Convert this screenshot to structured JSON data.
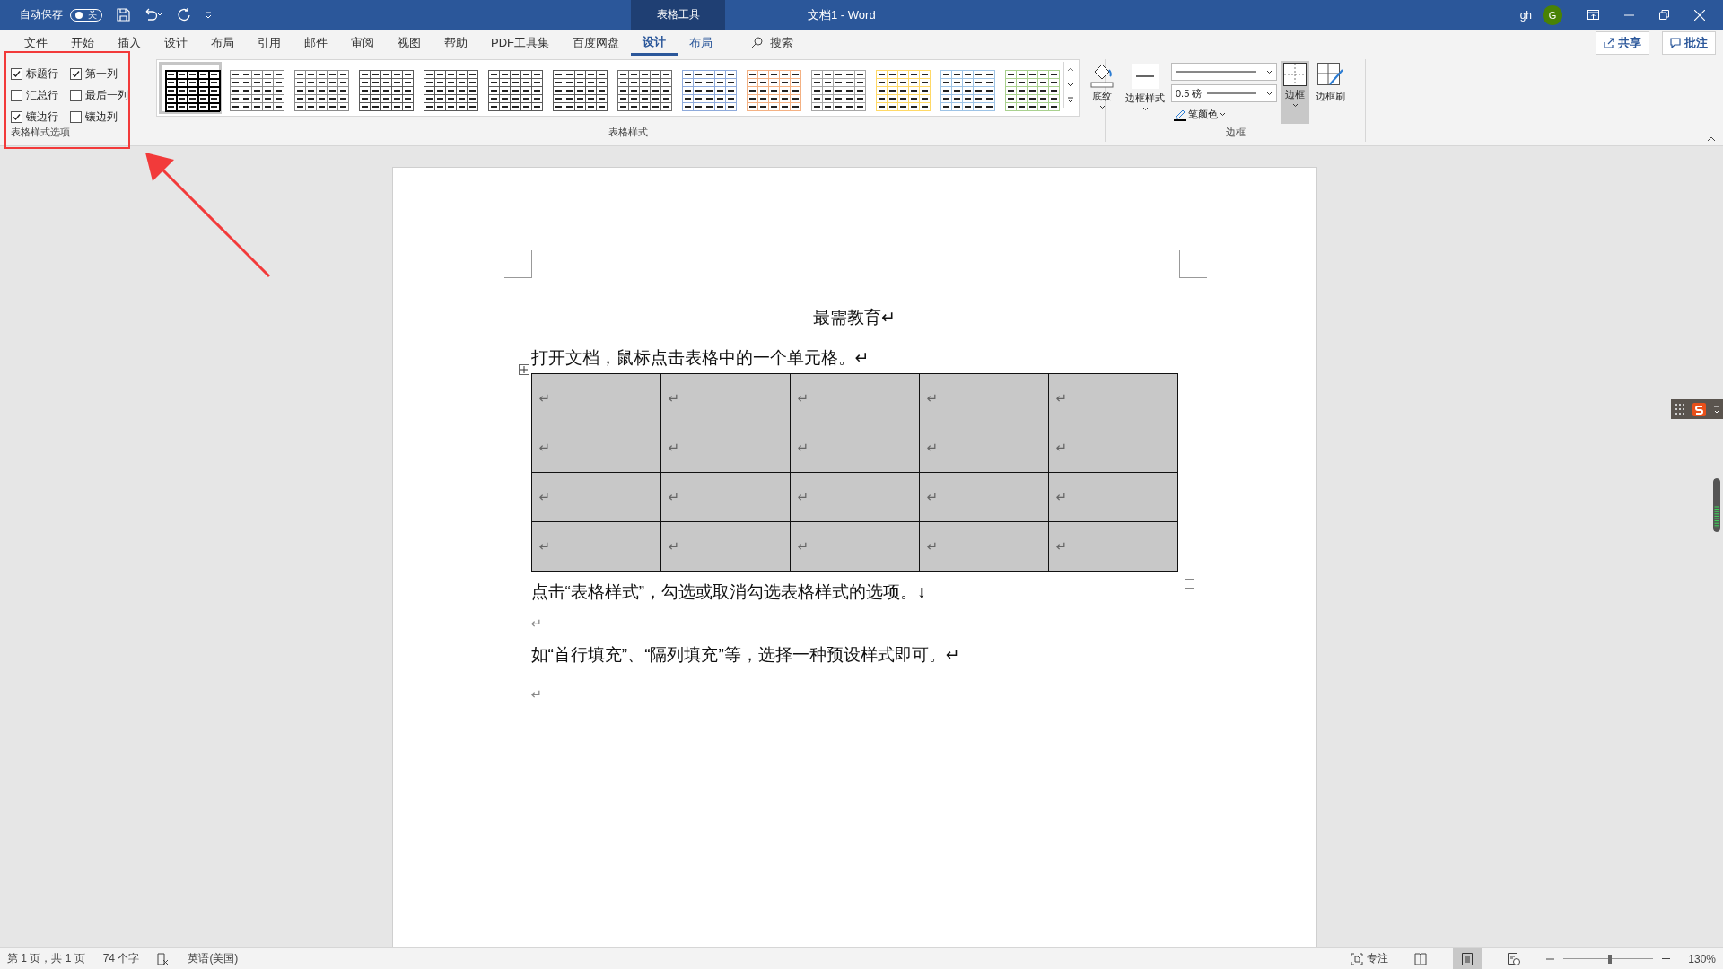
{
  "title_bar": {
    "autosave_label": "自动保存",
    "autosave_toggle": {
      "label": "关",
      "on": false
    },
    "context_tab": "表格工具",
    "title": "文档1  -  Word",
    "user": "gh",
    "avatar": "G"
  },
  "ribbon_tabs": [
    {
      "label": "文件",
      "selected": false,
      "contextual": false
    },
    {
      "label": "开始",
      "selected": false,
      "contextual": false
    },
    {
      "label": "插入",
      "selected": false,
      "contextual": false
    },
    {
      "label": "设计",
      "selected": false,
      "contextual": false
    },
    {
      "label": "布局",
      "selected": false,
      "contextual": false
    },
    {
      "label": "引用",
      "selected": false,
      "contextual": false
    },
    {
      "label": "邮件",
      "selected": false,
      "contextual": false
    },
    {
      "label": "审阅",
      "selected": false,
      "contextual": false
    },
    {
      "label": "视图",
      "selected": false,
      "contextual": false
    },
    {
      "label": "帮助",
      "selected": false,
      "contextual": false
    },
    {
      "label": "PDF工具集",
      "selected": false,
      "contextual": false
    },
    {
      "label": "百度网盘",
      "selected": false,
      "contextual": false
    },
    {
      "label": "设计",
      "selected": true,
      "contextual": true
    },
    {
      "label": "布局",
      "selected": false,
      "contextual": true
    }
  ],
  "search": {
    "placeholder": "搜索"
  },
  "share_button": "共享",
  "comments_button": "批注",
  "style_options": {
    "items": [
      {
        "label": "标题行",
        "checked": true
      },
      {
        "label": "第一列",
        "checked": true
      },
      {
        "label": "汇总行",
        "checked": false
      },
      {
        "label": "最后一列",
        "checked": false
      },
      {
        "label": "镶边行",
        "checked": true
      },
      {
        "label": "镶边列",
        "checked": false
      }
    ],
    "group_label": "表格样式选项"
  },
  "table_styles": {
    "items": [
      {
        "color": "#000000",
        "selected": true
      },
      {
        "color": "#8c8c8c",
        "selected": false
      },
      {
        "color": "#8c8c8c",
        "selected": false
      },
      {
        "color": "#5a5a5a",
        "selected": false
      },
      {
        "color": "#5a5a5a",
        "selected": false
      },
      {
        "color": "#5a5a5a",
        "selected": false
      },
      {
        "color": "#5a5a5a",
        "selected": false
      },
      {
        "color": "#6e6e6e",
        "selected": false
      },
      {
        "color": "#8eaadb",
        "selected": false
      },
      {
        "color": "#f4b183",
        "selected": false
      },
      {
        "color": "#a6a6a6",
        "selected": false
      },
      {
        "color": "#ffd966",
        "selected": false
      },
      {
        "color": "#9dc3e6",
        "selected": false
      },
      {
        "color": "#a9d18e",
        "selected": false
      }
    ],
    "group_label": "表格样式"
  },
  "shading_button": "底纹",
  "borders_group": {
    "border_styles": "边框样式",
    "pen_weight": "0.5 磅",
    "pen_color": "笔颜色",
    "borders": "边框",
    "borders_selected": true,
    "border_painter": "边框刷",
    "group_label": "边框"
  },
  "document": {
    "heading": "最需教育↵",
    "paragraph_1": "打开文档，鼠标点击表格中的一个单元格。↵",
    "table_rows": [
      [
        "↵",
        "↵",
        "↵",
        "↵",
        "↵"
      ],
      [
        "↵",
        "↵",
        "↵",
        "↵",
        "↵"
      ],
      [
        "↵",
        "↵",
        "↵",
        "↵",
        "↵"
      ],
      [
        "↵",
        "↵",
        "↵",
        "↵",
        "↵"
      ]
    ],
    "paragraph_2": "点击“表格样式”，勾选或取消勾选表格样式的选项。↓",
    "empty_1": "↵",
    "paragraph_3": "如“首行填充”、“隔列填充”等，选择一种预设样式即可。↵",
    "empty_2": "↵"
  },
  "status_bar": {
    "page": "第 1 页，共 1 页",
    "words": "74 个字",
    "language": "英语(美国)",
    "focus": "专注",
    "zoom": {
      "level": 0.52,
      "reading": "130%"
    }
  }
}
